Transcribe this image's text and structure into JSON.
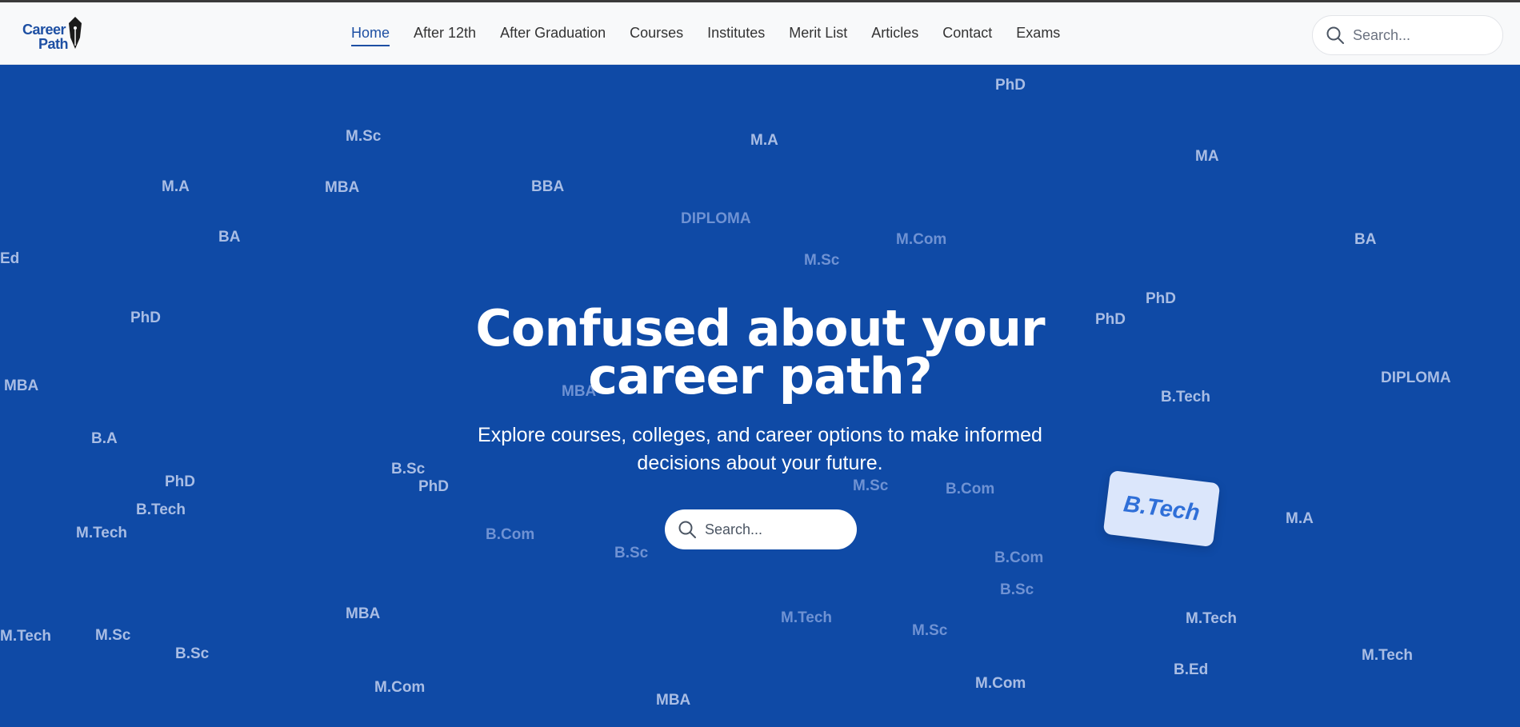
{
  "brand": {
    "line1": "Career",
    "line2": "Path"
  },
  "nav": {
    "items": [
      {
        "label": "Home"
      },
      {
        "label": "After 12th"
      },
      {
        "label": "After Graduation"
      },
      {
        "label": "Courses"
      },
      {
        "label": "Institutes"
      },
      {
        "label": "Merit List"
      },
      {
        "label": "Articles"
      },
      {
        "label": "Contact"
      },
      {
        "label": "Exams"
      }
    ],
    "active": "Home"
  },
  "top_search": {
    "placeholder": "Search..."
  },
  "hero": {
    "title_line1": "Confused about your",
    "title_line2": "career path?",
    "subtitle_line1": "Explore courses, colleges, and career options to make informed",
    "subtitle_line2": "decisions about your future.",
    "search_placeholder": "Search...",
    "badge": "B.Tech"
  },
  "background_words": [
    "PhD",
    "M.Sc",
    "M.A",
    "MA",
    "M.A",
    "MBA",
    "BBA",
    "DIPLOMA",
    "BA",
    "M.Com",
    "Ed",
    "M.Sc",
    "BA",
    "PhD",
    "PhD",
    "PhD",
    "MBA",
    "DIPLOMA",
    "B.Tech",
    "MBA",
    "B.A",
    "PhD",
    "B.Sc",
    "PhD",
    "M.Sc",
    "B.Com",
    "B.Tech",
    "M.Tech",
    "B.Com",
    "M.A",
    "B.Sc",
    "B.Com",
    "B.Sc",
    "MBA",
    "M.Tech",
    "M.Tech",
    "M.Tech",
    "M.Sc",
    "M.Sc",
    "B.Sc",
    "M.Tech",
    "B.Ed",
    "M.Com",
    "M.Com",
    "MBA"
  ],
  "colors": {
    "hero_bg": "#0f4aa6",
    "accent": "#1d4fa3",
    "badge_bg": "#dbe6fb"
  }
}
